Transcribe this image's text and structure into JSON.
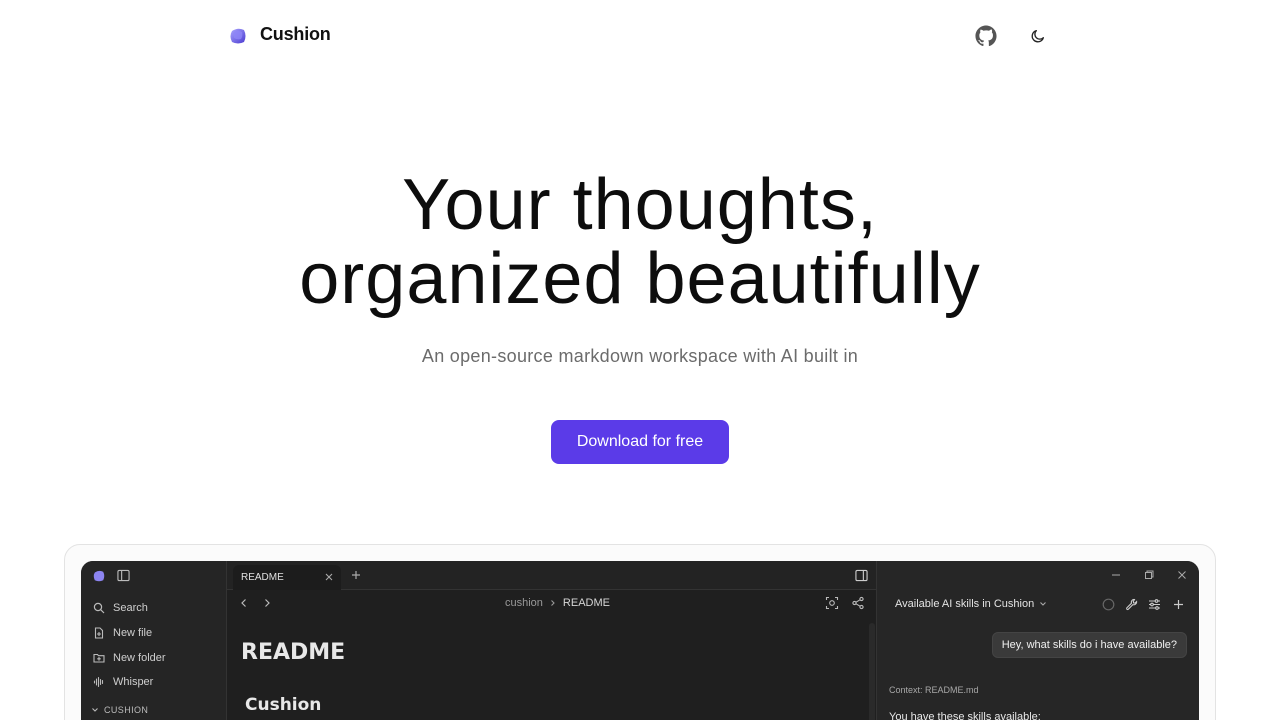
{
  "header": {
    "brand": "Cushion",
    "github_icon": "github-icon",
    "theme_icon": "moon-icon"
  },
  "hero": {
    "title_line1": "Your thoughts,",
    "title_line2": "organized beautifully",
    "subtitle": "An open-source markdown workspace with AI built in",
    "cta_label": "Download for free"
  },
  "colors": {
    "accent": "#5b3be8",
    "app_bg": "#1f1f1f"
  },
  "app": {
    "sidebar": {
      "items": [
        {
          "label": "Search",
          "icon": "search-icon"
        },
        {
          "label": "New file",
          "icon": "file-plus-icon"
        },
        {
          "label": "New folder",
          "icon": "folder-plus-icon"
        },
        {
          "label": "Whisper",
          "icon": "waveform-icon"
        }
      ],
      "section": "CUSHION"
    },
    "editor": {
      "tab_label": "README",
      "breadcrumb_root": "cushion",
      "breadcrumb_current": "README",
      "doc_title": "README",
      "doc_heading": "Cushion"
    },
    "ai_panel": {
      "title": "Available AI skills in Cushion",
      "user_message": "Hey, what skills do i have available?",
      "context": "Context: README.md",
      "reply": "You have these skills available:"
    }
  }
}
